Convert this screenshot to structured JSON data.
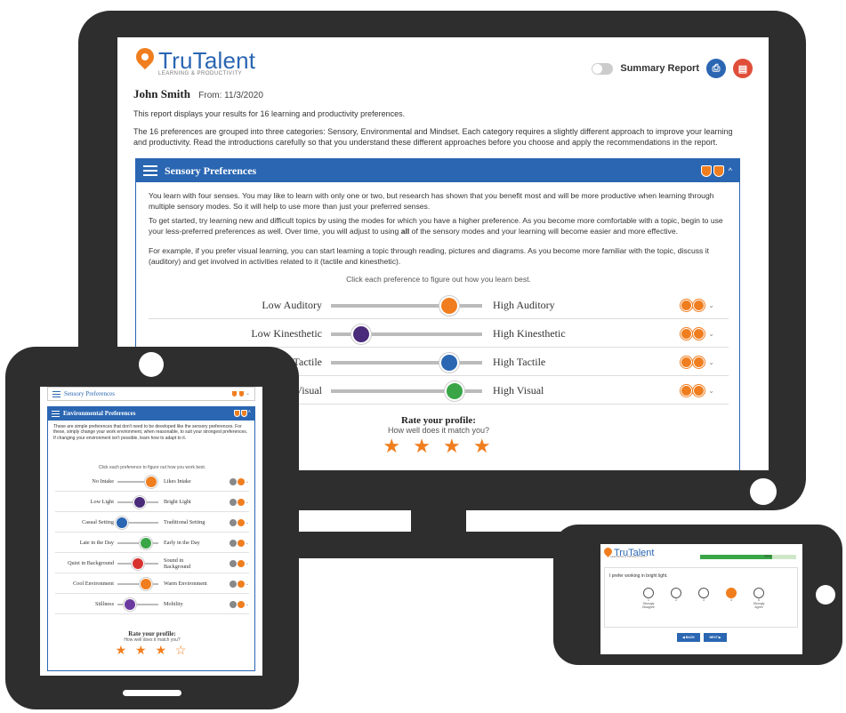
{
  "colors": {
    "brand_blue": "#2a66b2",
    "brand_orange": "#f07e1f",
    "device_frame": "#2e2e2e",
    "progress_green": "#39a547"
  },
  "desktop": {
    "brand": {
      "name": "TruTalent",
      "registered": "®",
      "subtitle": "LEARNING & PRODUCTIVITY"
    },
    "user": {
      "name": "John Smith",
      "from": "From: 11/3/2020"
    },
    "summary_toggle": {
      "label": "Summary Report",
      "on": false
    },
    "intro_1": "This report displays your results for 16 learning and productivity preferences.",
    "intro_2": "The 16 preferences are grouped into three categories: Sensory, Environmental and Mindset. Each category requires a slightly different approach to improve your learning and productivity. Read the introductions carefully so that you understand these different approaches before you choose and apply the recommendations in the report.",
    "panel": {
      "title": "Sensory Preferences",
      "para_1": "You learn with four senses. You may like to learn with only one or two, but research has shown that you benefit most and will be more productive when learning through multiple sensory modes. So it will help to use more than just your preferred senses.",
      "para_2_a": "To get started, try learning new and difficult topics by using the modes for which you have a higher preference. As you become more comfortable with a topic, begin to use your less-preferred preferences as well. Over time, you will adjust to using ",
      "para_2_bold": "all",
      "para_2_b": " of the sensory modes and your learning will become easier and more effective.",
      "para_3": "For example, if you prefer visual learning, you can start learning a topic through reading, pictures and diagrams. As you become more familiar with the topic, discuss it (auditory) and get involved in activities related to it (tactile and kinesthetic).",
      "hint": "Click each preference to figure out how you learn best.",
      "rows": [
        {
          "low": "Low Auditory",
          "high": "High Auditory",
          "position": 0.78,
          "color": "#f07e1f"
        },
        {
          "low": "Low Kinesthetic",
          "high": "High Kinesthetic",
          "position": 0.2,
          "color": "#4a2a7a"
        },
        {
          "low": "Tactile",
          "high": "High Tactile",
          "position": 0.78,
          "color": "#2a66b2"
        },
        {
          "low": "Visual",
          "high": "High Visual",
          "position": 0.82,
          "color": "#39a547"
        }
      ],
      "rating": {
        "title": "Rate your profile:",
        "subtitle": "How well does it match you?",
        "stars": "★ ★ ★ ★"
      }
    }
  },
  "tablet": {
    "closed_title": "Sensory Preferences",
    "open_title": "Environmental Preferences",
    "text": "These are simple preferences that don't need to be developed like the sensory preferences. For these, simply change your work environment, when reasonable, to suit your strongest preferences. If changing your environment isn't possible, learn how to adapt to it.",
    "hint": "Click each preference to figure out how you work best.",
    "rows": [
      {
        "low": "No Intake",
        "high": "Likes Intake",
        "position": 0.82,
        "color": "#f07e1f"
      },
      {
        "low": "Low Light",
        "high": "Bright Light",
        "position": 0.55,
        "color": "#4a2a7a"
      },
      {
        "low": "Casual Setting",
        "high": "Traditional Setting",
        "position": 0.1,
        "color": "#2a66b2"
      },
      {
        "low": "Late in the Day",
        "high": "Early in the Day",
        "position": 0.7,
        "color": "#39a547"
      },
      {
        "low": "Quiet in Background",
        "high": "Sound in Background",
        "position": 0.5,
        "color": "#d8322e"
      },
      {
        "low": "Cool Environment",
        "high": "Warm Environment",
        "position": 0.7,
        "color": "#f07e1f"
      },
      {
        "low": "Stillness",
        "high": "Mobility",
        "position": 0.3,
        "color": "#6a3aa0"
      }
    ],
    "rating": {
      "title": "Rate your profile:",
      "subtitle": "How well does it match you?",
      "stars": "★ ★ ★ ☆"
    }
  },
  "phone": {
    "brand": "TruTalent",
    "subtitle": "LEARNING & PRODUCTIVITY",
    "progress_label": "75%",
    "progress": 0.75,
    "question": "I prefer working in bright light.",
    "options": [
      {
        "num": "1",
        "label": "Strongly Disagree",
        "selected": false
      },
      {
        "num": "2",
        "label": "",
        "selected": false
      },
      {
        "num": "3",
        "label": "",
        "selected": false
      },
      {
        "num": "4",
        "label": "",
        "selected": true
      },
      {
        "num": "5",
        "label": "Strongly Agree",
        "selected": false
      }
    ],
    "back_label": "◀ BACK",
    "next_label": "NEXT ▶"
  }
}
